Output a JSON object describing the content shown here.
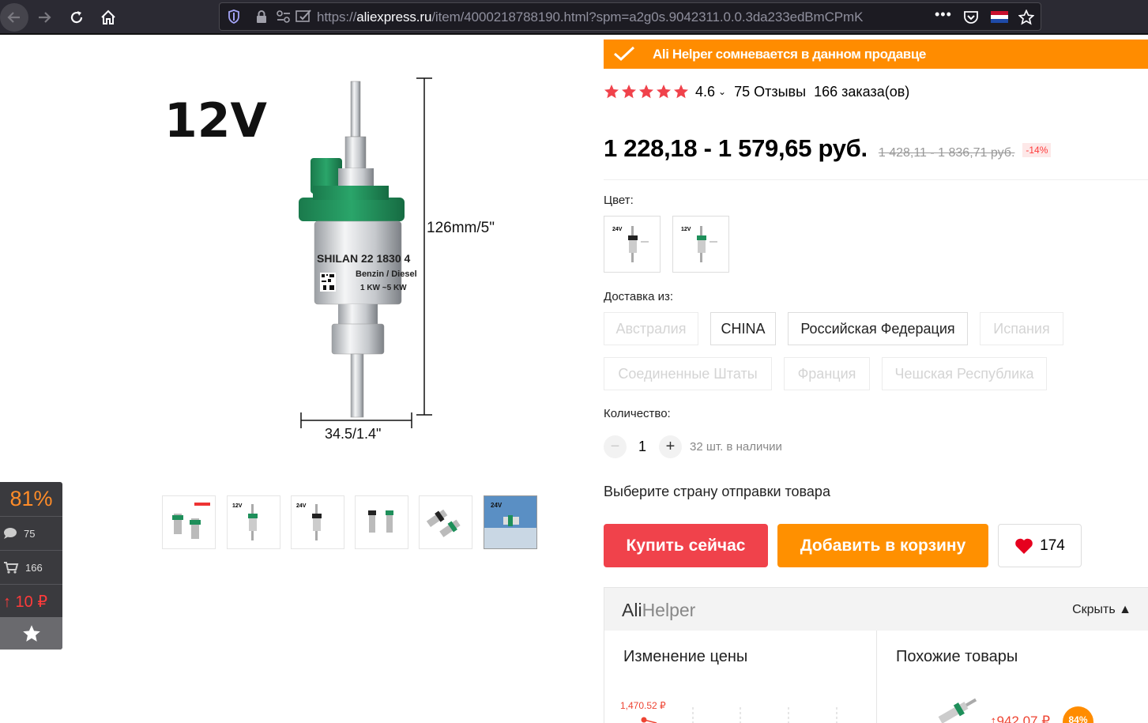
{
  "browser": {
    "url_prefix": "https://",
    "url_domain": "aliexpress.ru",
    "url_path": "/item/4000218788190.html?spm=a2g0s.9042311.0.0.3da233edBmCPmK",
    "more_icon": "•••"
  },
  "product_image": {
    "voltage_label": "12V",
    "height_label": "126mm/5\"",
    "width_label": "34.5/1.4\"",
    "body_text_1": "SHILAN  22  1830 4",
    "body_text_2": "Benzin / Diesel",
    "body_text_3": "1 KW ~5 KW"
  },
  "thumbnails": [
    {
      "name": "thumb-1",
      "tag": ""
    },
    {
      "name": "thumb-2",
      "tag": "12V"
    },
    {
      "name": "thumb-3",
      "tag": "24V"
    },
    {
      "name": "thumb-4",
      "tag": ""
    },
    {
      "name": "thumb-5",
      "tag": ""
    },
    {
      "name": "thumb-6",
      "tag": "24V"
    }
  ],
  "widget": {
    "percent": "81%",
    "reviews": "75",
    "orders": "166",
    "price_change": "↑ 10 ₽"
  },
  "warning": {
    "text": "Ali Helper сомневается в данном продавце"
  },
  "rating": {
    "value": "4.6",
    "chevron": "⌄",
    "reviews": "75 Отзывы",
    "orders": "166 заказа(ов)",
    "stars": 5
  },
  "price": {
    "current": "1 228,18 - 1 579,65 руб.",
    "old": "1 428,11 - 1 836,71 руб.",
    "discount": "-14%"
  },
  "color": {
    "label": "Цвет:",
    "options": [
      "24V",
      "12V"
    ]
  },
  "shipping": {
    "label": "Доставка из:",
    "options": [
      "Австралия",
      "CHINA",
      "Российская Федерация",
      "Испания",
      "Соединенные Штаты",
      "Франция",
      "Чешская Республика"
    ]
  },
  "quantity": {
    "label": "Количество:",
    "minus": "−",
    "value": "1",
    "plus": "+",
    "stock": "32 шт. в наличии"
  },
  "choose_country": "Выберите страну отправки товара",
  "buttons": {
    "buy": "Купить сейчас",
    "cart": "Добавить в корзину",
    "wish_count": "174"
  },
  "helper": {
    "logo_part1": "Ali",
    "logo_part2": "Helper",
    "hide": "Скрыть  ▲",
    "price_change_title": "Изменение цены",
    "similar_title": "Похожие товары",
    "chart_first_value": "1,470.52 ₽",
    "similar_price": "↑942,07 ₽",
    "similar_badge": "84%"
  },
  "colors": {
    "accent_red": "#f0424b",
    "accent_orange": "#ff9000",
    "warning_bg": "#ff8c00",
    "pump_green": "#1e8f5a"
  }
}
